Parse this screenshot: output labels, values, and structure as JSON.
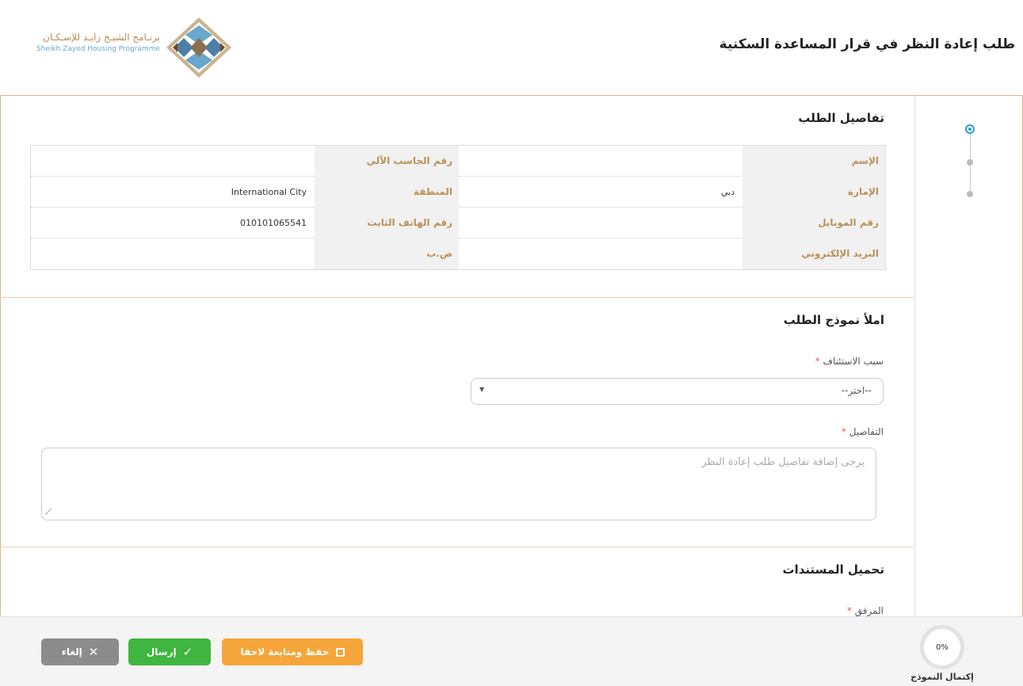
{
  "header": {
    "title": "طلب إعادة النظر في قرار المساعدة السكنية",
    "logo_ar": "برنـامج الشيـخ زايـد للإسـكـان",
    "logo_en": "Sheikh Zayed Housing Programme"
  },
  "details": {
    "title": "تفاصيل الطلب",
    "rows": [
      {
        "label_r": "الإسم",
        "value_r": "",
        "label_l": "رقم الحاسب الآلي",
        "value_l": ""
      },
      {
        "label_r": "الإمارة",
        "value_r": "دبي",
        "label_l": "المنطقة",
        "value_l": "International City"
      },
      {
        "label_r": "رقم الموبايل",
        "value_r": "",
        "label_l": "رقم الهاتف الثابت",
        "value_l": "010101065541"
      },
      {
        "label_r": "البريد الإلكتروني",
        "value_r": "",
        "label_l": "ص.ب",
        "value_l": ""
      }
    ]
  },
  "form": {
    "title": "املأ نموذج الطلب",
    "reason_label": "سبب الاستئناف",
    "reason_value": "--اختر--",
    "details_label": "التفاصيل",
    "details_placeholder": "يرجى إضافة تفاصيل طلب إعادة النظر",
    "required_mark": "*"
  },
  "documents": {
    "title": "تحميل المستندات",
    "attachment_label": "المرفق"
  },
  "footer": {
    "save_label": "حفظ ومتابعة لاحقا",
    "submit_label": "إرسال",
    "cancel_label": "إلغاء",
    "progress_value": "0%",
    "progress_label": "إكتمال النموذج"
  },
  "colors": {
    "accent_gold": "#b8915a",
    "save_orange": "#f6a53a",
    "submit_green": "#3fb63f",
    "cancel_gray": "#8c8c8c",
    "step_active": "#2a9fd8"
  }
}
